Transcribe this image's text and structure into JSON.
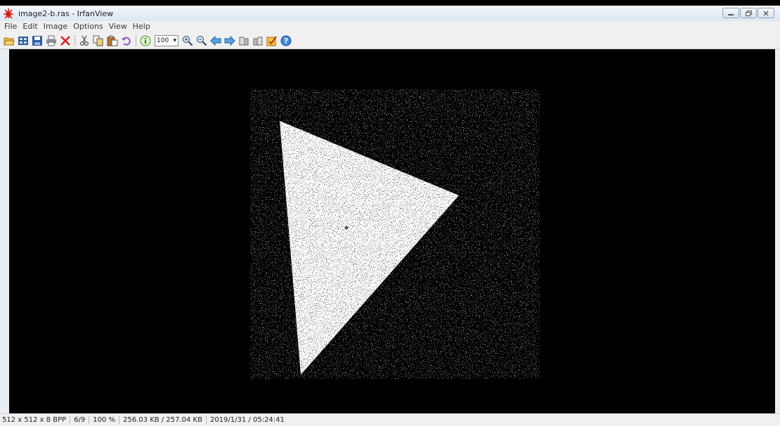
{
  "window": {
    "title": "image2-b.ras - IrfanView",
    "controls": [
      "minimize-icon",
      "restore-icon",
      "close-icon"
    ]
  },
  "menu": [
    "File",
    "Edit",
    "Image",
    "Options",
    "View",
    "Help"
  ],
  "toolbar": {
    "icons": [
      "open-folder-icon",
      "thumbnails-icon",
      "save-icon",
      "print-icon",
      "delete-icon",
      "cut-icon",
      "copy-icon",
      "paste-icon",
      "undo-icon",
      "info-icon",
      "zoom-in-icon",
      "zoom-out-icon",
      "previous-icon",
      "next-icon",
      "slideshow-prev-icon",
      "slideshow-next-icon",
      "edit-icon",
      "help-icon"
    ],
    "zoom_value": "100"
  },
  "status": {
    "dimensions": "512 x 512 x 8 BPP",
    "file_index": "6/9",
    "zoom": "100 %",
    "size": "256.03 KB / 257.04 KB",
    "datetime": "2019/1/31 / 05:24:41"
  },
  "colors": {
    "canvas": "#000000",
    "shape": "#ffffff",
    "accent_red": "#d0201a"
  }
}
